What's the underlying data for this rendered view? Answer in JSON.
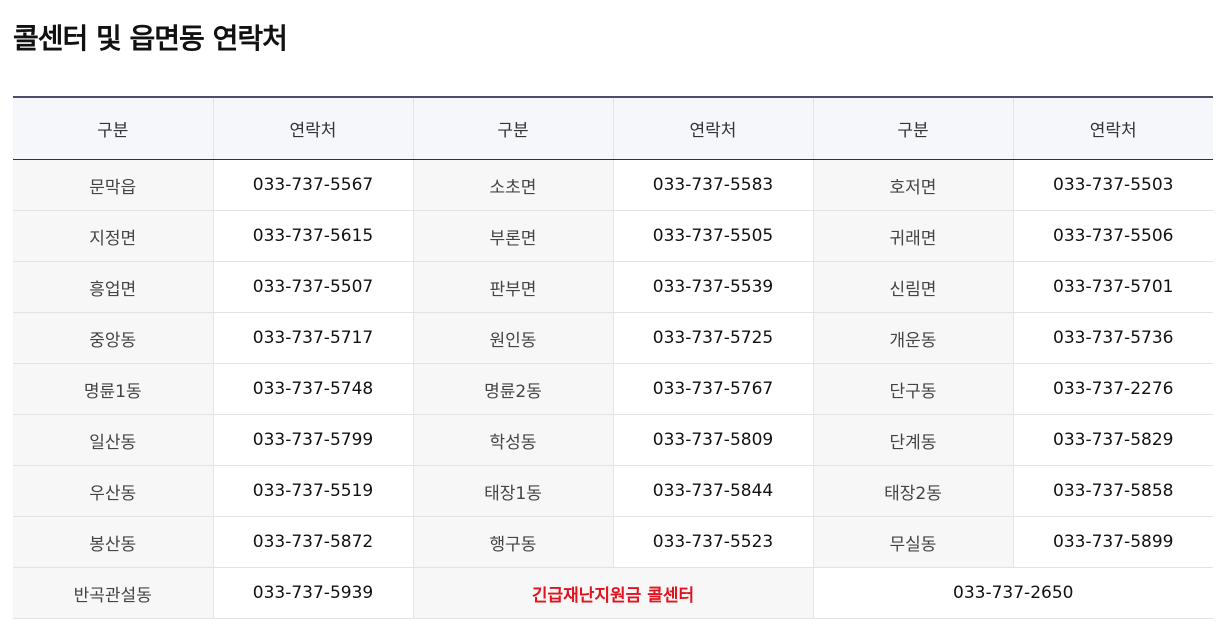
{
  "page": {
    "title": "콜센터 및 읍면동 연락처"
  },
  "table": {
    "headers": [
      "구분",
      "연락처",
      "구분",
      "연락처",
      "구분",
      "연락처"
    ],
    "rows": [
      [
        {
          "area": "문막읍",
          "phone": "033-737-5567"
        },
        {
          "area": "소초면",
          "phone": "033-737-5583"
        },
        {
          "area": "호저면",
          "phone": "033-737-5503"
        }
      ],
      [
        {
          "area": "지정면",
          "phone": "033-737-5615"
        },
        {
          "area": "부론면",
          "phone": "033-737-5505"
        },
        {
          "area": "귀래면",
          "phone": "033-737-5506"
        }
      ],
      [
        {
          "area": "흥업면",
          "phone": "033-737-5507"
        },
        {
          "area": "판부면",
          "phone": "033-737-5539"
        },
        {
          "area": "신림면",
          "phone": "033-737-5701"
        }
      ],
      [
        {
          "area": "중앙동",
          "phone": "033-737-5717"
        },
        {
          "area": "원인동",
          "phone": "033-737-5725"
        },
        {
          "area": "개운동",
          "phone": "033-737-5736"
        }
      ],
      [
        {
          "area": "명륜1동",
          "phone": "033-737-5748"
        },
        {
          "area": "명륜2동",
          "phone": "033-737-5767"
        },
        {
          "area": "단구동",
          "phone": "033-737-2276"
        }
      ],
      [
        {
          "area": "일산동",
          "phone": "033-737-5799"
        },
        {
          "area": "학성동",
          "phone": "033-737-5809"
        },
        {
          "area": "단계동",
          "phone": "033-737-5829"
        }
      ],
      [
        {
          "area": "우산동",
          "phone": "033-737-5519"
        },
        {
          "area": "태장1동",
          "phone": "033-737-5844"
        },
        {
          "area": "태장2동",
          "phone": "033-737-5858"
        }
      ],
      [
        {
          "area": "봉산동",
          "phone": "033-737-5872"
        },
        {
          "area": "행구동",
          "phone": "033-737-5523"
        },
        {
          "area": "무실동",
          "phone": "033-737-5899"
        }
      ]
    ],
    "last_row": {
      "area": "반곡관설동",
      "phone": "033-737-5939",
      "callcenter_label": "긴급재난지원금 콜센터",
      "callcenter_phone": "033-737-2650"
    }
  },
  "colors": {
    "header_border": "#4a4f66",
    "header_bg": "#f6f7fa",
    "area_bg": "#f7f7f7",
    "callcenter_text": "#e0141e"
  }
}
